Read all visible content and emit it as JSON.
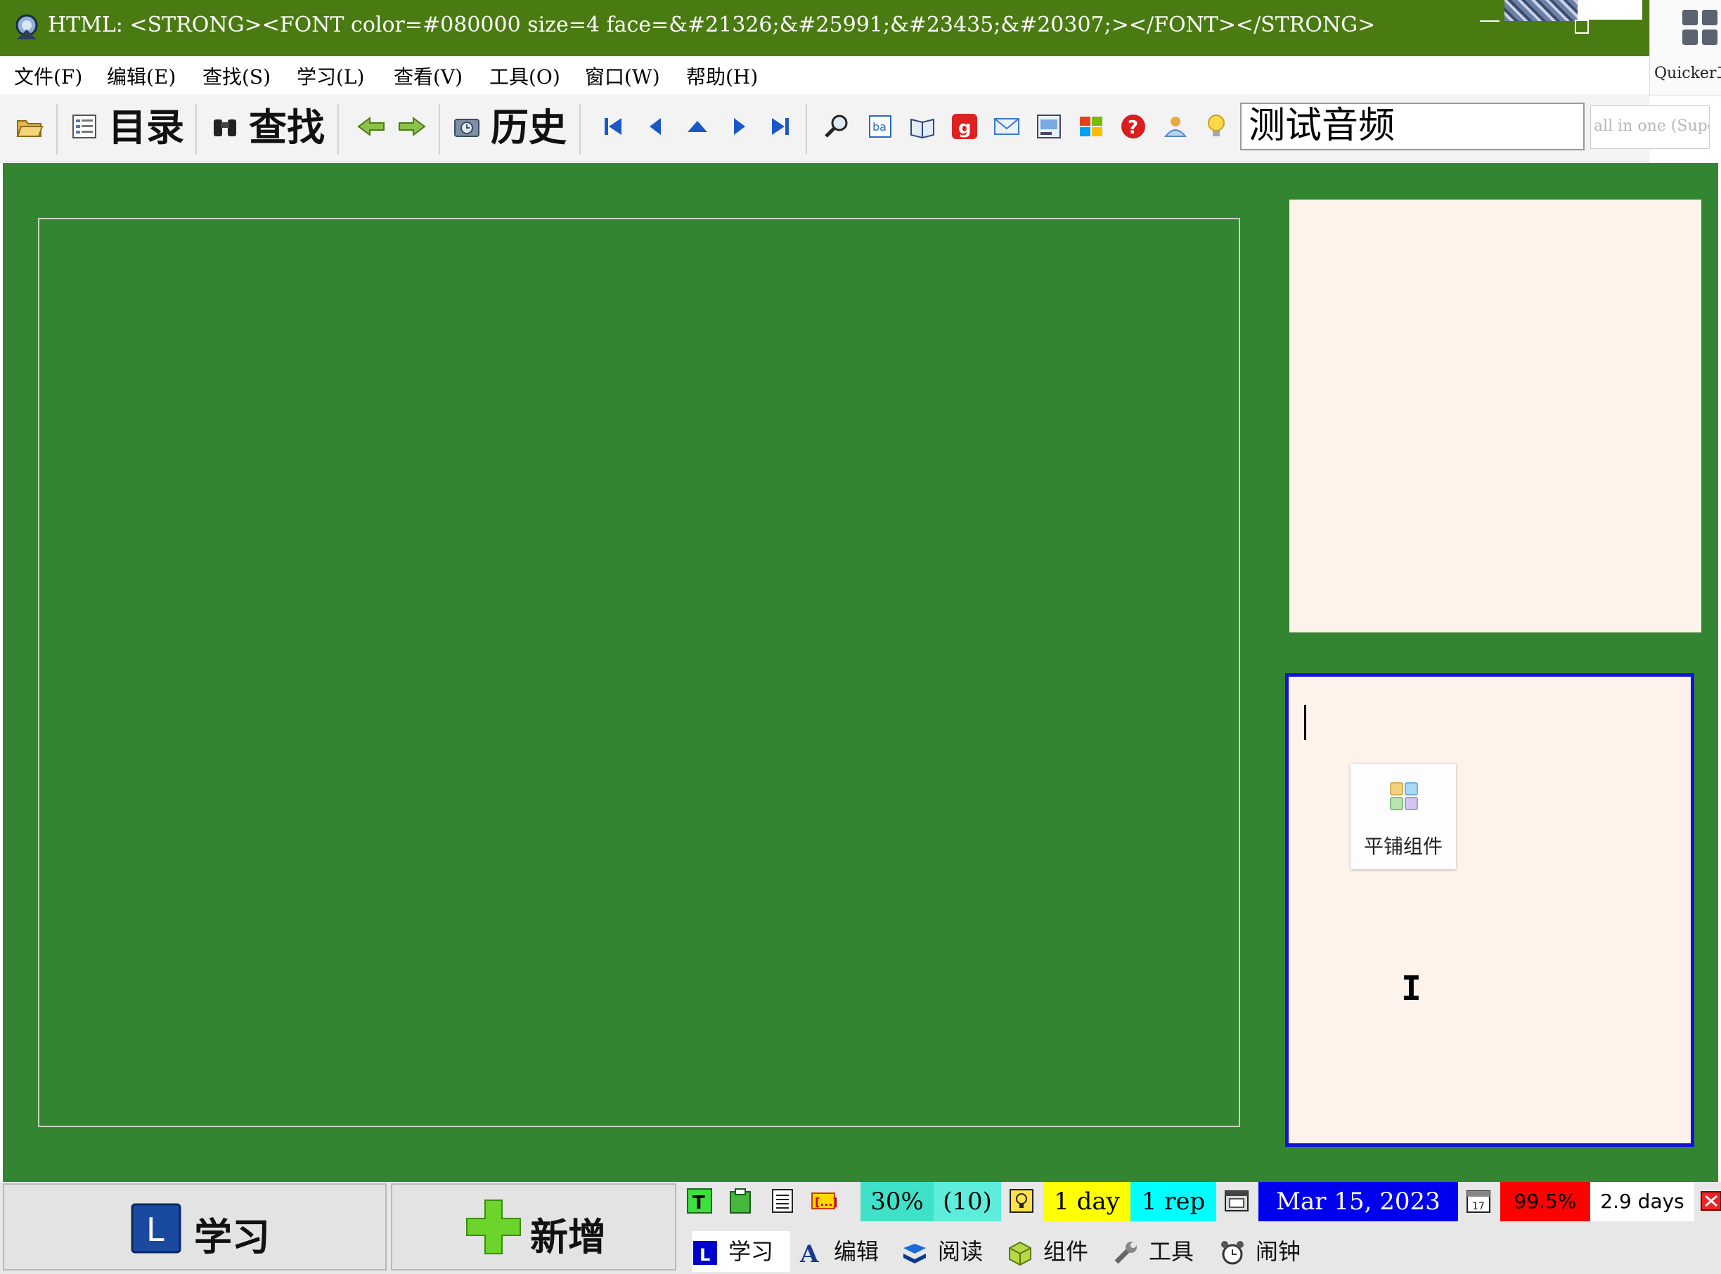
{
  "window": {
    "title": "HTML: <STRONG><FONT color=#080000 size=4 face=&#21326;&#25991;&#23435;&#20307;></FONT></STRONG>",
    "minimize_glyph": "—",
    "quicker_label": "Quicker工"
  },
  "menu": {
    "items": [
      "文件(F)",
      "编辑(E)",
      "查找(S)",
      "学习(L)",
      "查看(V)",
      "工具(O)",
      "窗口(W)",
      "帮助(H)"
    ]
  },
  "toolbar": {
    "contents_label": "目录",
    "search_label": "查找",
    "history_label": "历史",
    "title_field_value": "测试音频",
    "secondary_field_value": "all in one (Supe"
  },
  "element_panel": {
    "tile_widget_label": "平铺组件",
    "ibeam_glyph": "I"
  },
  "bottom": {
    "learn_label": "学习",
    "learn_badge": "L",
    "add_label": "新增",
    "stats": {
      "percent": "30%",
      "count": "(10)",
      "interval": "1 day",
      "reps": "1 rep",
      "date": "Mar 15, 2023",
      "retention": "99.5%",
      "days": "2.9 days"
    },
    "mode_tabs": [
      "学习",
      "编辑",
      "阅读",
      "组件",
      "工具",
      "闹钟"
    ],
    "mode_badge": "L"
  },
  "colors": {
    "title_bar": "#4a7a12",
    "workspace": "#348531",
    "panel_bg": "#fdf3ea",
    "panel_border_active": "#1414d8",
    "stat_percent": "#3fe2c8",
    "stat_count": "#5eeddb",
    "stat_interval": "#ffff00",
    "stat_reps": "#00ffff",
    "stat_date": "#0000ee",
    "stat_retention": "#ff0000"
  }
}
